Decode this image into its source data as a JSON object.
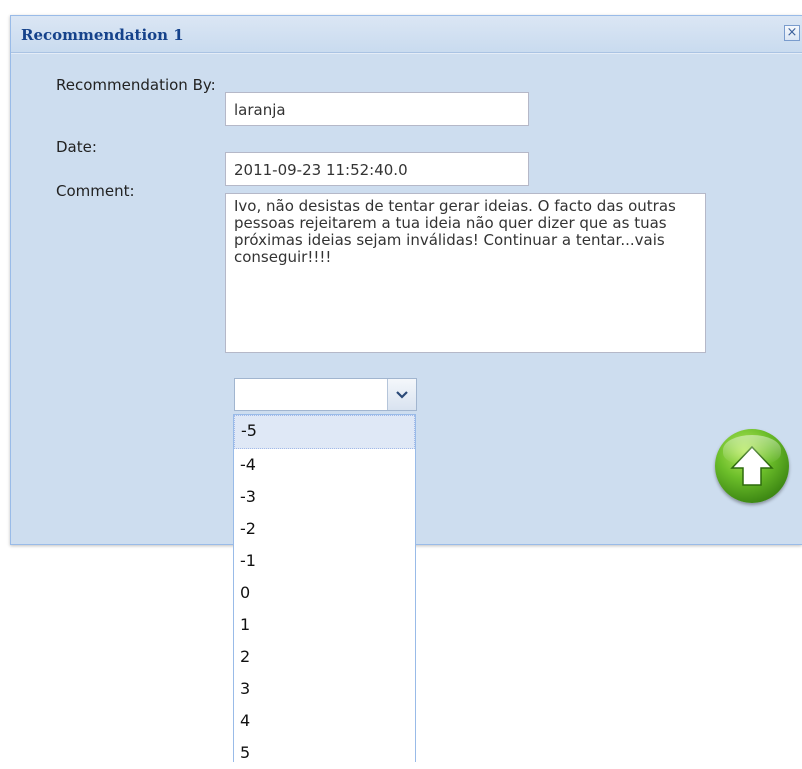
{
  "window": {
    "title": "Recommendation 1",
    "close_label": "×"
  },
  "form": {
    "recommendation_by_label": "Recommendation By:",
    "recommendation_by_value": "laranja",
    "date_label": "Date:",
    "date_value": "2011-09-23 11:52:40.0",
    "comment_label": "Comment:",
    "comment_value": "Ivo, não desistas de tentar gerar ideias. O facto das outras pessoas rejeitarem a tua ideia não quer dizer que as tuas próximas ideias sejam inválidas! Continuar a tentar...vais conseguir!!!!"
  },
  "rating_combo": {
    "value": "",
    "options": [
      "-5",
      "-4",
      "-3",
      "-2",
      "-1",
      "0",
      "1",
      "2",
      "3",
      "4",
      "5"
    ],
    "highlighted": "-5"
  },
  "icons": {
    "submit": "up-arrow-icon",
    "dropdown": "chevron-down-icon",
    "close": "close-icon"
  },
  "colors": {
    "title": "#15428b",
    "panel": "#cdddef",
    "submit_green": "#4a9a1c"
  }
}
